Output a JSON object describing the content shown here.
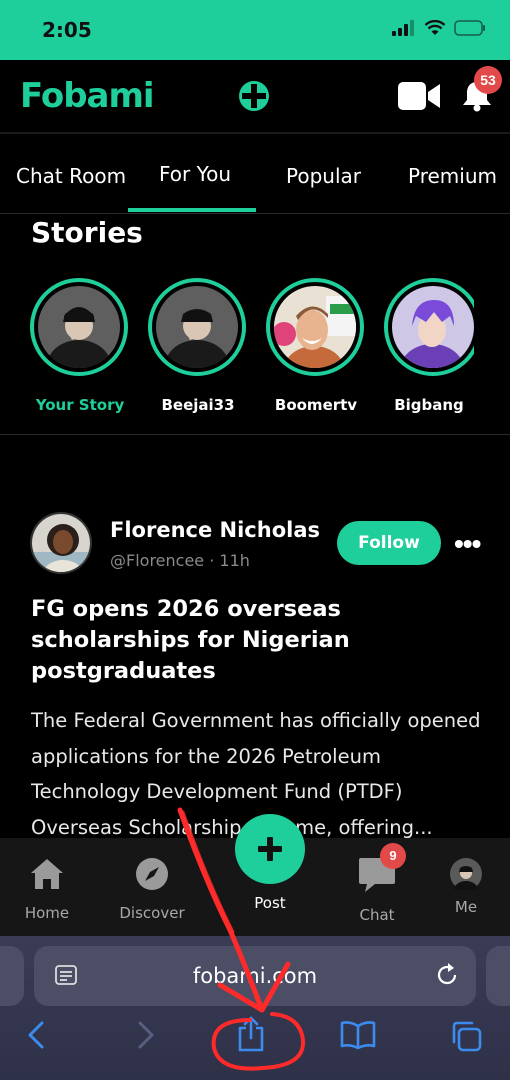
{
  "status_bar": {
    "time": "2:05"
  },
  "header": {
    "logo": "Fobami",
    "notification_count": "53"
  },
  "tabs": [
    {
      "label": "Chat Room"
    },
    {
      "label": "For You"
    },
    {
      "label": "Popular"
    },
    {
      "label": "Premium"
    }
  ],
  "stories": {
    "title": "Stories",
    "items": [
      {
        "label": "Your Story"
      },
      {
        "label": "Beejai33"
      },
      {
        "label": "Boomertv"
      },
      {
        "label": "Bigbang"
      }
    ]
  },
  "post": {
    "author": "Florence Nicholas",
    "handle": "@Florencee  ·  11h",
    "follow_label": "Follow",
    "headline": "FG opens 2026 overseas scholarships for Nigerian postgraduates",
    "body": "The Federal Government has officially opened applications for the 2026 Petroleum Technology Development Fund (PTDF) Overseas Scholarship Scheme, offering..."
  },
  "bottom_nav": {
    "home": "Home",
    "discover": "Discover",
    "post": "Post",
    "chat": "Chat",
    "chat_badge": "9",
    "me": "Me"
  },
  "browser": {
    "url": "fobami.com"
  },
  "colors": {
    "accent": "#1fcf9b",
    "badge": "#e24a4a",
    "annotation": "#ff2a2a"
  }
}
